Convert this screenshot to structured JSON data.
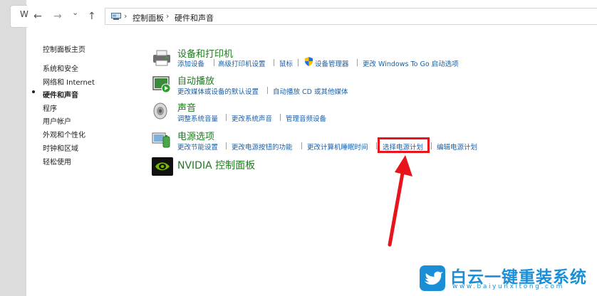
{
  "window": {
    "title_fragment": "W"
  },
  "nav": {
    "back_icon": "←",
    "forward_icon": "→",
    "dropdown_icon": "⌄",
    "up_icon": "↑"
  },
  "address_bar": {
    "crumbs": [
      "控制面板",
      "硬件和声音"
    ],
    "separator": "›"
  },
  "sidebar": {
    "items": [
      {
        "label": "控制面板主页"
      },
      {
        "label": "系统和安全"
      },
      {
        "label": "网络和 Internet"
      },
      {
        "label": "硬件和声音",
        "active": true
      },
      {
        "label": "程序"
      },
      {
        "label": "用户帐户"
      },
      {
        "label": "外观和个性化"
      },
      {
        "label": "时钟和区域"
      },
      {
        "label": "轻松使用"
      }
    ]
  },
  "categories": [
    {
      "title": "设备和打印机",
      "icon": "printer-icon",
      "links": [
        "添加设备",
        "高级打印机设置",
        "鼠标",
        "设备管理器",
        "更改 Windows To Go 启动选项"
      ]
    },
    {
      "title": "自动播放",
      "icon": "autoplay-icon",
      "links": [
        "更改媒体或设备的默认设置",
        "自动播放 CD 或其他媒体"
      ]
    },
    {
      "title": "声音",
      "icon": "speaker-icon",
      "links": [
        "调整系统音量",
        "更改系统声音",
        "管理音频设备"
      ]
    },
    {
      "title": "电源选项",
      "icon": "power-options-icon",
      "links": [
        "更改节能设置",
        "更改电源按钮的功能",
        "更改计算机睡眠时间",
        "选择电源计划",
        "编辑电源计划"
      ]
    },
    {
      "title": "NVIDIA 控制面板",
      "icon": "nvidia-icon",
      "links": []
    }
  ],
  "annotation": {
    "highlight_color": "#e8141c",
    "highlighted_link": "选择电源计划"
  },
  "watermark": {
    "title": "白云一键重装系统",
    "url": "www.baiyunxitong.com",
    "color": "#1a8fd8"
  }
}
